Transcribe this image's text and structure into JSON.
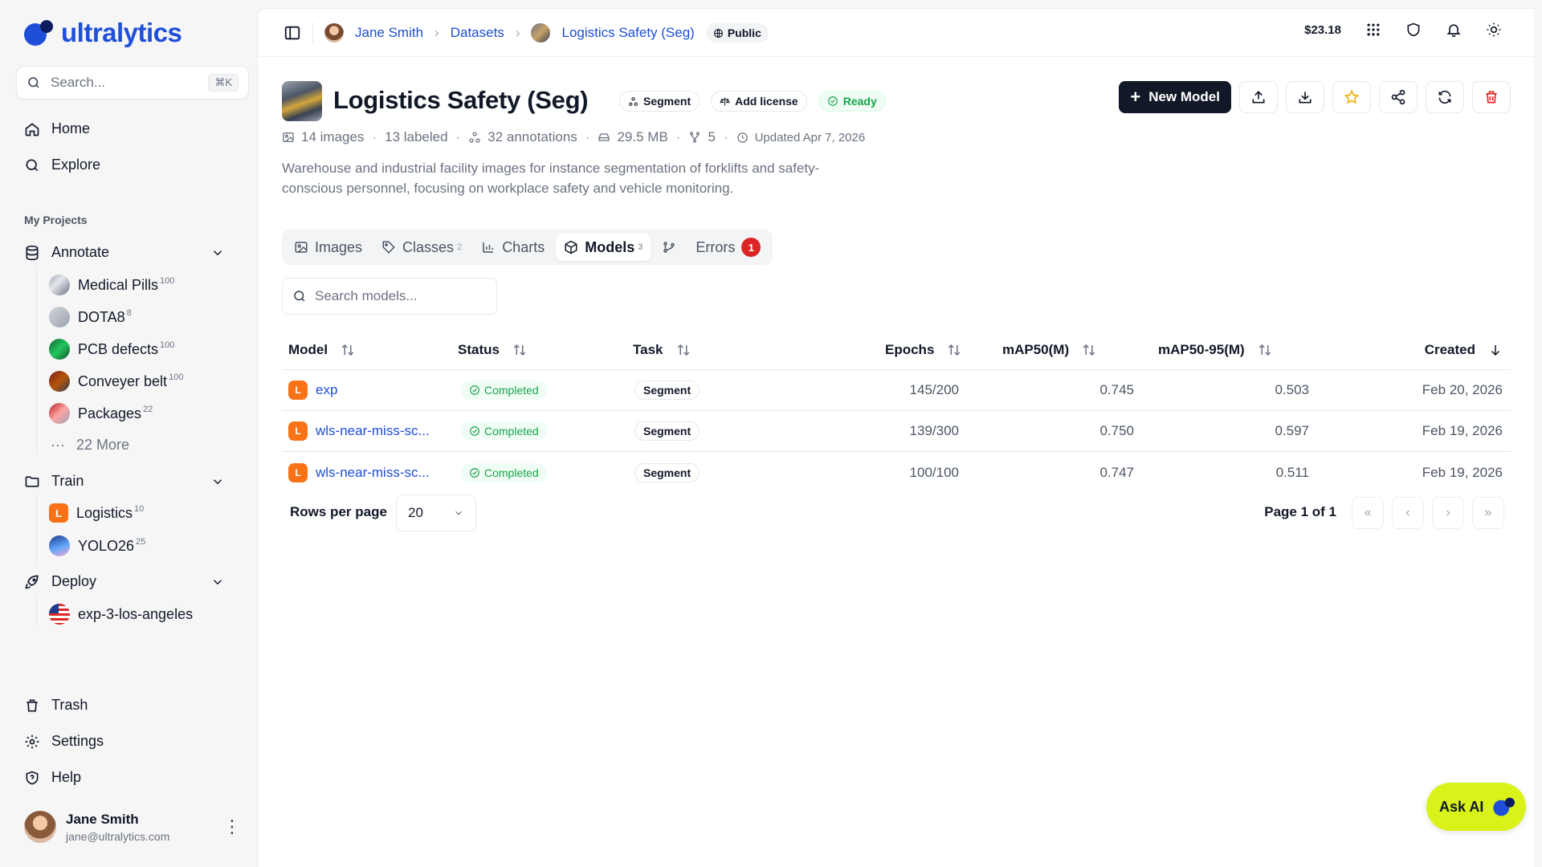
{
  "sidebar": {
    "logo_text": "ultralytics",
    "search": {
      "placeholder": "Search...",
      "shortcut": "⌘K"
    },
    "nav": [
      {
        "label": "Home",
        "icon": "home-icon"
      },
      {
        "label": "Explore",
        "icon": "search-icon"
      }
    ],
    "section_label": "My Projects",
    "annotate": {
      "label": "Annotate",
      "items": [
        {
          "label": "Medical Pills",
          "count": "100"
        },
        {
          "label": "DOTA8",
          "count": "8"
        },
        {
          "label": "PCB defects",
          "count": "100"
        },
        {
          "label": "Conveyer belt",
          "count": "100"
        },
        {
          "label": "Packages",
          "count": "22"
        }
      ],
      "more_label": "22 More"
    },
    "train": {
      "label": "Train",
      "items": [
        {
          "label": "Logistics",
          "count": "10",
          "initial": "L"
        },
        {
          "label": "YOLO26",
          "count": "25"
        }
      ]
    },
    "deploy": {
      "label": "Deploy",
      "items": [
        {
          "label": "exp-3-los-angeles"
        }
      ]
    },
    "bottom": [
      {
        "label": "Trash"
      },
      {
        "label": "Settings"
      },
      {
        "label": "Help"
      }
    ],
    "user": {
      "name": "Jane Smith",
      "email": "jane@ultralytics.com"
    }
  },
  "topbar": {
    "breadcrumb": {
      "user": "Jane Smith",
      "datasets": "Datasets",
      "dataset": "Logistics Safety (Seg)",
      "visibility": "Public"
    },
    "balance": "$23.18"
  },
  "dataset": {
    "title": "Logistics Safety (Seg)",
    "badges": {
      "task": "Segment",
      "license": "Add license",
      "status": "Ready"
    },
    "meta": {
      "images": "14 images",
      "labeled": "13 labeled",
      "annotations": "32 annotations",
      "size": "29.5 MB",
      "forks": "5",
      "updated": "Updated Apr 7, 2026"
    },
    "description": "Warehouse and industrial facility images for instance segmentation of forklifts and safety-conscious personnel, focusing on workplace safety and vehicle monitoring.",
    "new_model_label": "New Model"
  },
  "tabs": {
    "images": "Images",
    "classes": "Classes",
    "classes_count": "2",
    "charts": "Charts",
    "models": "Models",
    "models_count": "3",
    "errors": "Errors",
    "errors_count": "1"
  },
  "models": {
    "search_placeholder": "Search models...",
    "columns": {
      "model": "Model",
      "status": "Status",
      "task": "Task",
      "epochs": "Epochs",
      "map50": "mAP50(M)",
      "map5095": "mAP50-95(M)",
      "created": "Created"
    },
    "rows": [
      {
        "initial": "L",
        "name": "exp",
        "status": "Completed",
        "task": "Segment",
        "epochs": "145/200",
        "map50": "0.745",
        "map5095": "0.503",
        "created": "Feb 20, 2026"
      },
      {
        "initial": "L",
        "name": "wls-near-miss-sc...",
        "status": "Completed",
        "task": "Segment",
        "epochs": "139/300",
        "map50": "0.750",
        "map5095": "0.597",
        "created": "Feb 19, 2026"
      },
      {
        "initial": "L",
        "name": "wls-near-miss-sc...",
        "status": "Completed",
        "task": "Segment",
        "epochs": "100/100",
        "map50": "0.747",
        "map5095": "0.511",
        "created": "Feb 19, 2026"
      }
    ],
    "rows_per_page_label": "Rows per page",
    "rows_per_page": "20",
    "page_label": "Page 1 of 1"
  },
  "ask_ai_label": "Ask AI",
  "colors": {
    "accent": "#1d4ed8",
    "ask_ai": "#d9f31a",
    "model_badge": "#f97316",
    "success": "#16a34a",
    "danger": "#dc2626"
  }
}
